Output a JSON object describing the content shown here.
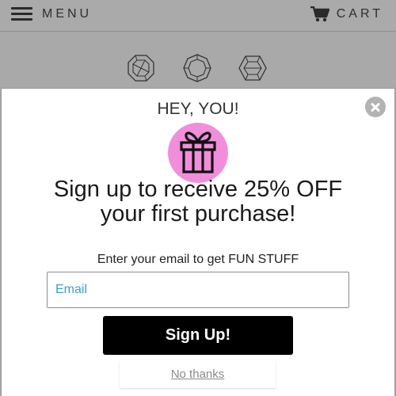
{
  "header": {
    "menu_label": "MENU",
    "cart_label": "CART"
  },
  "gems": [
    "octagon-gem-icon",
    "round-gem-icon",
    "hexagon-gem-icon"
  ],
  "modal": {
    "greeting": "HEY, YOU!",
    "headline_line1": "Sign up to receive 25% OFF",
    "headline_line2": "your first purchase!",
    "subtext": "Enter your email to get FUN STUFF",
    "email_value": "",
    "email_placeholder": "Email",
    "signup_label": "Sign Up!",
    "no_thanks_label": "No thanks",
    "gift_circle_color": "#f18edb"
  }
}
